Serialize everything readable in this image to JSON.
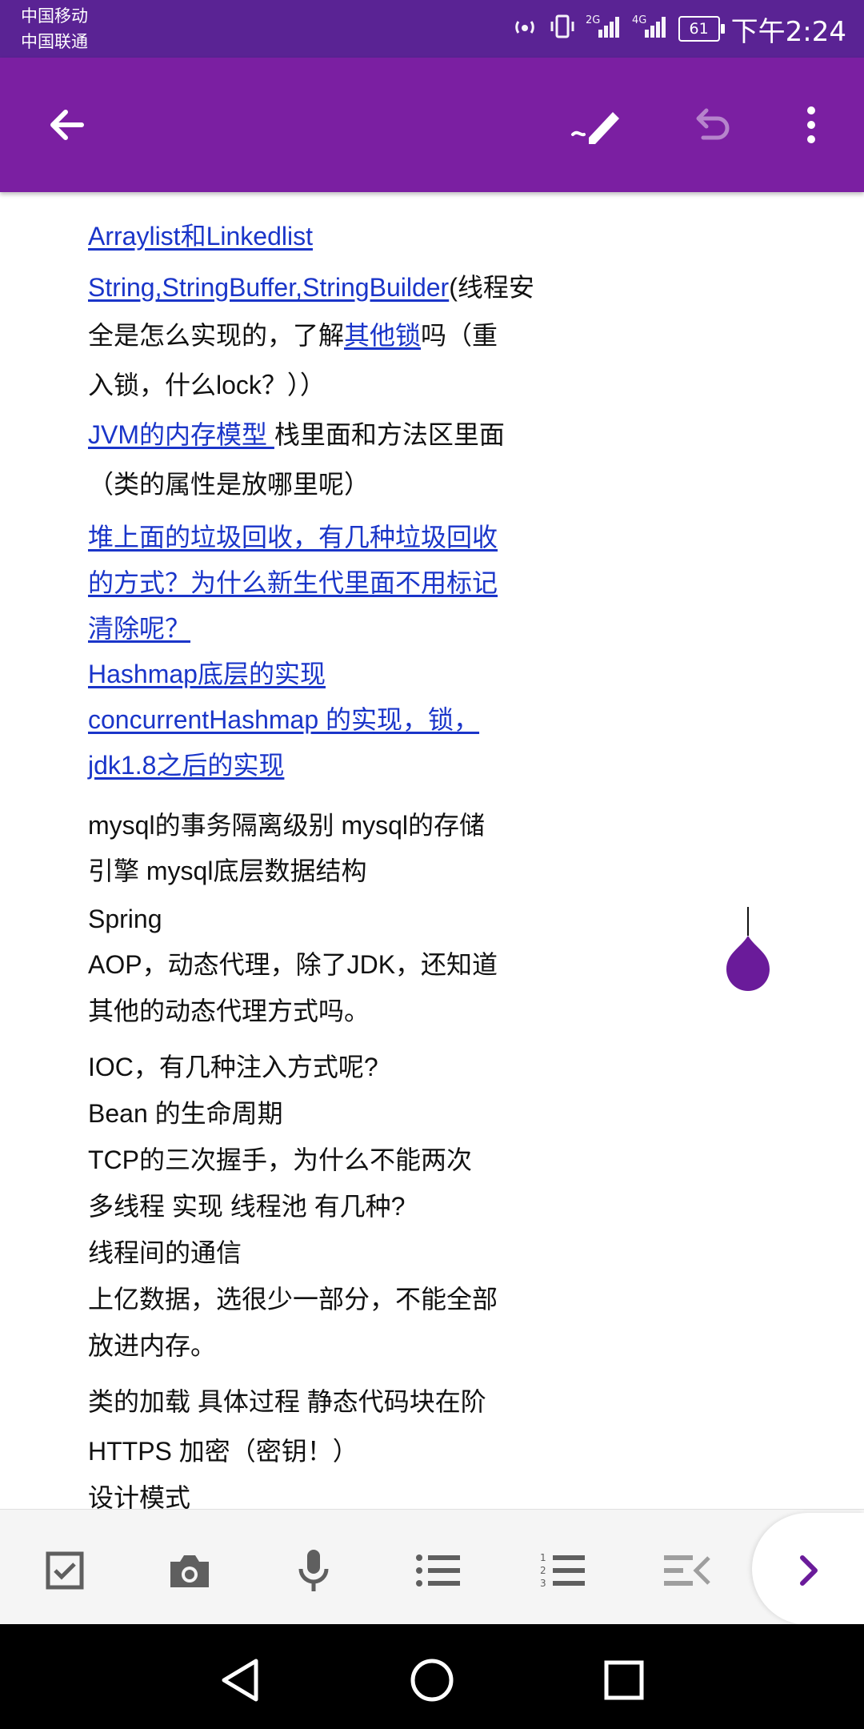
{
  "status_bar": {
    "carrier1": "中国移动",
    "carrier2": "中国联通",
    "network1": "2G",
    "network2": "4G",
    "battery": "61",
    "time": "下午2:24"
  },
  "toolbar": {
    "back_icon": "arrow-left",
    "pen_icon": "pen",
    "undo_icon": "undo",
    "more_icon": "more-vertical"
  },
  "note": {
    "items": [
      {
        "text": "Arraylist和Linkedlist"
      },
      {
        "link": "String,StringBuffer,StringBuilder",
        "text": "(线程安"
      },
      {
        "text": "全是怎么实现的，了解",
        "link": "其他锁",
        "text2": "吗（重"
      },
      {
        "text": "入锁，什么lock？））"
      },
      {
        "link": "JVM的内存模型 ",
        "text": "栈里面和方法区里面"
      },
      {
        "text": "（类的属性是放哪里呢）"
      },
      {
        "link": "堆上面的垃圾回收，有几种垃圾回收"
      },
      {
        "link": "的方式？为什么新生代里面不用标记"
      },
      {
        "link": "清除呢？ "
      },
      {
        "link": "Hashmap底层的实现"
      },
      {
        "link": "concurrentHashmap 的实现，锁，"
      },
      {
        "link": "jdk1.8之后的实现"
      },
      {
        "text": "mysql的事务隔离级别   mysql的存储"
      },
      {
        "text": "引擎    mysql底层数据结构"
      },
      {
        "text": "Spring"
      },
      {
        "text": "AOP，动态代理，除了JDK，还知道"
      },
      {
        "text": "其他的动态代理方式吗。"
      },
      {
        "text": "IOC，有几种注入方式呢?"
      },
      {
        "text": "Bean 的生命周期"
      },
      {
        "text": "TCP的三次握手，为什么不能两次"
      },
      {
        "text": "多线程 实现        线程池 有几种?"
      },
      {
        "text": "线程间的通信"
      },
      {
        "text": "上亿数据，选很少一部分，不能全部"
      },
      {
        "text": "放进内存。"
      },
      {
        "text": "类的加载 具体过程 静态代码块在阶"
      },
      {
        "text": "HTTPS 加密（密钥！）"
      },
      {
        "text": "设计模式"
      }
    ]
  },
  "bottom_toolbar": {
    "icons": [
      "checkbox-icon",
      "camera-icon",
      "microphone-icon",
      "bulleted-list-icon",
      "numbered-list-icon",
      "outdent-icon",
      "chevron-right-icon"
    ]
  },
  "nav_bar": {
    "icons": [
      "back-triangle-icon",
      "home-circle-icon",
      "recents-square-icon"
    ]
  },
  "colors": {
    "status_bar": "#5a2394",
    "toolbar": "#7b1fa2",
    "link": "#1a35c9",
    "accent": "#6a1b9a"
  }
}
